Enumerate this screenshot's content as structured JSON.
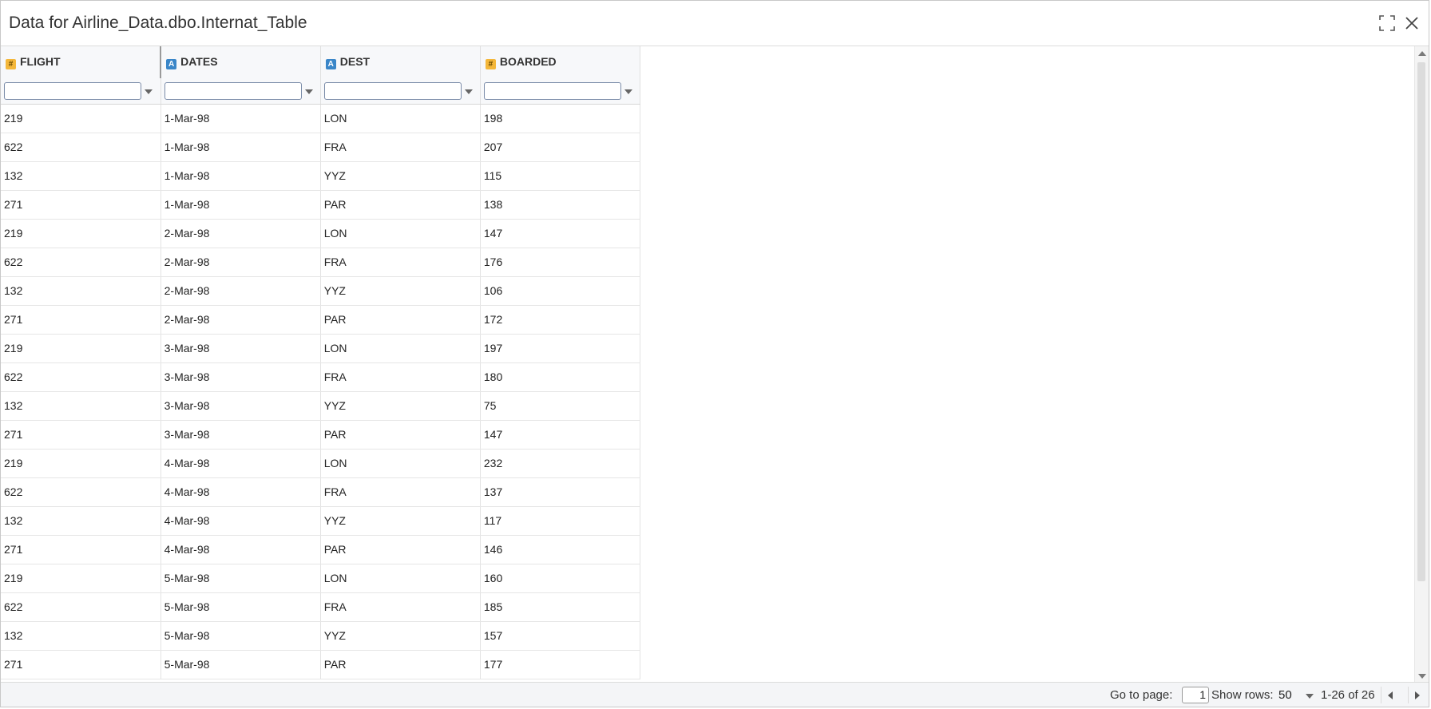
{
  "dialog": {
    "title": "Data for Airline_Data.dbo.Internat_Table",
    "maximize_icon": "maximize-icon",
    "close_icon": "close-icon"
  },
  "grid": {
    "columns": [
      {
        "name": "FLIGHT",
        "type_icon": "#",
        "type": "numeric"
      },
      {
        "name": "DATES",
        "type_icon": "A",
        "type": "text"
      },
      {
        "name": "DEST",
        "type_icon": "A",
        "type": "text"
      },
      {
        "name": "BOARDED",
        "type_icon": "#",
        "type": "numeric"
      }
    ],
    "filters": [
      "",
      "",
      "",
      ""
    ],
    "rows": [
      [
        "219",
        "1-Mar-98",
        "LON",
        "198"
      ],
      [
        "622",
        "1-Mar-98",
        "FRA",
        "207"
      ],
      [
        "132",
        "1-Mar-98",
        "YYZ",
        "115"
      ],
      [
        "271",
        "1-Mar-98",
        "PAR",
        "138"
      ],
      [
        "219",
        "2-Mar-98",
        "LON",
        "147"
      ],
      [
        "622",
        "2-Mar-98",
        "FRA",
        "176"
      ],
      [
        "132",
        "2-Mar-98",
        "YYZ",
        "106"
      ],
      [
        "271",
        "2-Mar-98",
        "PAR",
        "172"
      ],
      [
        "219",
        "3-Mar-98",
        "LON",
        "197"
      ],
      [
        "622",
        "3-Mar-98",
        "FRA",
        "180"
      ],
      [
        "132",
        "3-Mar-98",
        "YYZ",
        "75"
      ],
      [
        "271",
        "3-Mar-98",
        "PAR",
        "147"
      ],
      [
        "219",
        "4-Mar-98",
        "LON",
        "232"
      ],
      [
        "622",
        "4-Mar-98",
        "FRA",
        "137"
      ],
      [
        "132",
        "4-Mar-98",
        "YYZ",
        "117"
      ],
      [
        "271",
        "4-Mar-98",
        "PAR",
        "146"
      ],
      [
        "219",
        "5-Mar-98",
        "LON",
        "160"
      ],
      [
        "622",
        "5-Mar-98",
        "FRA",
        "185"
      ],
      [
        "132",
        "5-Mar-98",
        "YYZ",
        "157"
      ],
      [
        "271",
        "5-Mar-98",
        "PAR",
        "177"
      ]
    ]
  },
  "footer": {
    "go_to_page_label": "Go to page:",
    "page_value": "1",
    "show_rows_label": "Show rows:",
    "rows_per_page": "50",
    "range_text": "1-26 of 26",
    "prev_icon": "chevron-left-icon",
    "next_icon": "chevron-right-icon"
  },
  "colors": {
    "numeric_badge": "#f4b73a",
    "text_badge": "#3a86c8",
    "header_bg": "#f7f8fa"
  }
}
